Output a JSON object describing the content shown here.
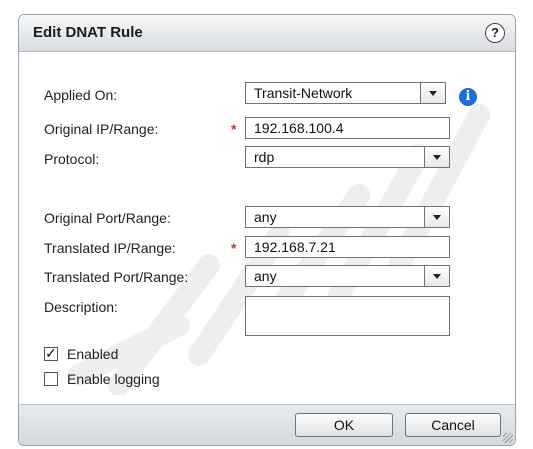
{
  "dialog": {
    "title": "Edit DNAT Rule",
    "help_glyph": "?"
  },
  "form": {
    "applied_on": {
      "label": "Applied On:",
      "value": "Transit-Network"
    },
    "original_ip": {
      "label": "Original IP/Range:",
      "required": "*",
      "value": "192.168.100.4"
    },
    "protocol": {
      "label": "Protocol:",
      "value": "rdp"
    },
    "original_port": {
      "label": "Original Port/Range:",
      "value": "any"
    },
    "translated_ip": {
      "label": "Translated IP/Range:",
      "required": "*",
      "value": "192.168.7.21"
    },
    "translated_port": {
      "label": "Translated Port/Range:",
      "value": "any"
    },
    "description": {
      "label": "Description:",
      "value": ""
    },
    "enabled": {
      "label": "Enabled",
      "checked": true,
      "check_glyph": "✓"
    },
    "enable_logging": {
      "label": "Enable logging",
      "checked": false
    }
  },
  "info_glyph": "i",
  "buttons": {
    "ok": "OK",
    "cancel": "Cancel"
  },
  "colors": {
    "accent": "#1f6fd1",
    "required": "#c0392b"
  },
  "icons": [
    "help-icon",
    "info-icon",
    "chevron-down-icon",
    "checkmark-icon",
    "resize-grip-icon"
  ]
}
